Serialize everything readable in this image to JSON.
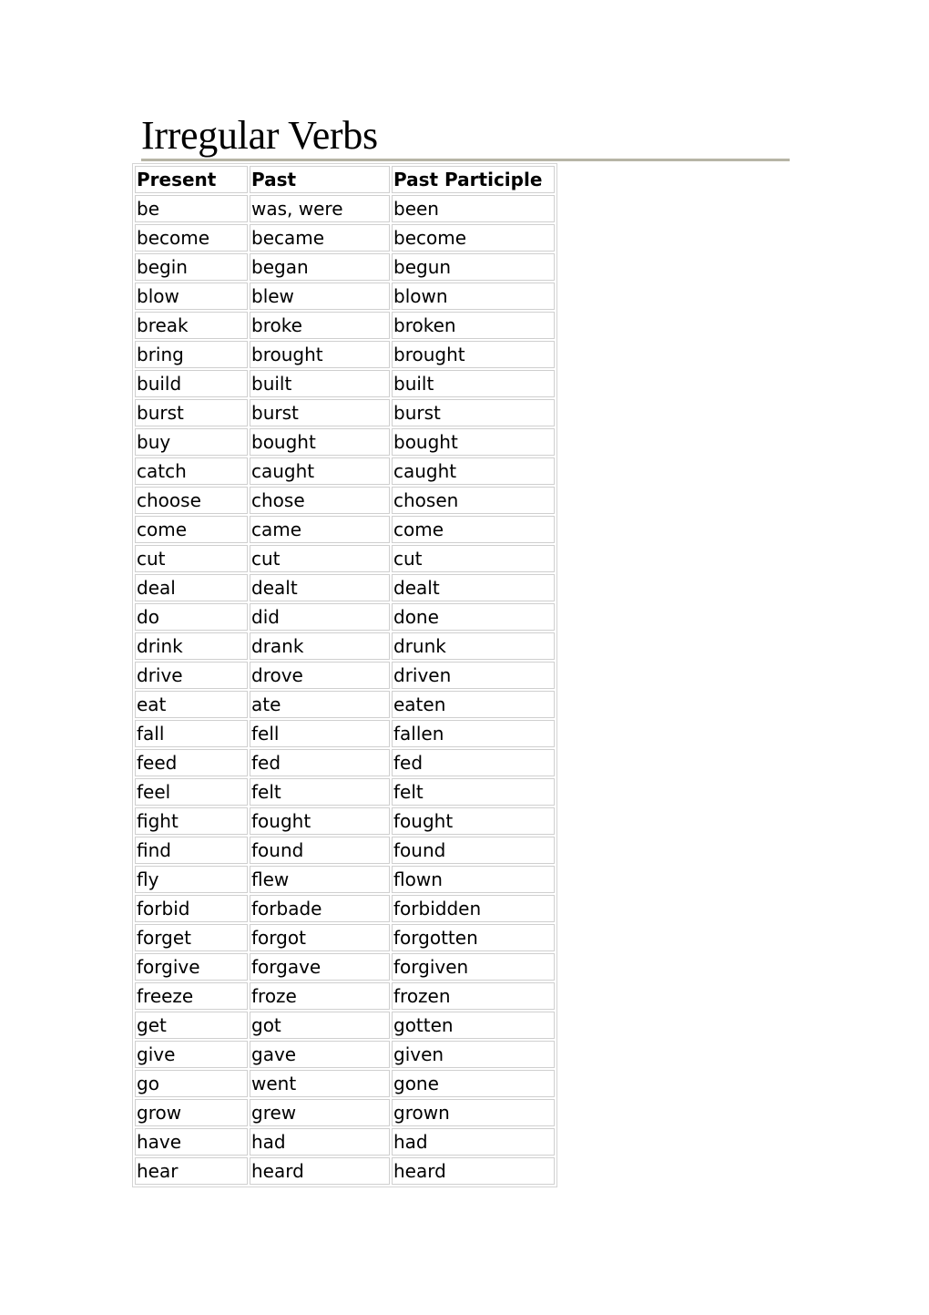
{
  "title": "Irregular Verbs",
  "table": {
    "headers": [
      "Present",
      "Past",
      "Past Participle"
    ],
    "rows": [
      [
        "be",
        "was, were",
        "been"
      ],
      [
        "become",
        "became",
        "become"
      ],
      [
        "begin",
        "began",
        "begun"
      ],
      [
        "blow",
        "blew",
        "blown"
      ],
      [
        "break",
        "broke",
        "broken"
      ],
      [
        "bring",
        "brought",
        "brought"
      ],
      [
        "build",
        "built",
        "built"
      ],
      [
        "burst",
        "burst",
        "burst"
      ],
      [
        "buy",
        "bought",
        "bought"
      ],
      [
        "catch",
        "caught",
        "caught"
      ],
      [
        "choose",
        "chose",
        "chosen"
      ],
      [
        "come",
        "came",
        "come"
      ],
      [
        "cut",
        "cut",
        "cut"
      ],
      [
        "deal",
        "dealt",
        "dealt"
      ],
      [
        "do",
        "did",
        "done"
      ],
      [
        "drink",
        "drank",
        "drunk"
      ],
      [
        "drive",
        "drove",
        "driven"
      ],
      [
        "eat",
        "ate",
        "eaten"
      ],
      [
        "fall",
        "fell",
        "fallen"
      ],
      [
        "feed",
        "fed",
        "fed"
      ],
      [
        "feel",
        "felt",
        "felt"
      ],
      [
        "fight",
        "fought",
        "fought"
      ],
      [
        "find",
        "found",
        "found"
      ],
      [
        "fly",
        "flew",
        "flown"
      ],
      [
        "forbid",
        "forbade",
        "forbidden"
      ],
      [
        "forget",
        "forgot",
        "forgotten"
      ],
      [
        "forgive",
        "forgave",
        "forgiven"
      ],
      [
        "freeze",
        "froze",
        "frozen"
      ],
      [
        "get",
        "got",
        "gotten"
      ],
      [
        "give",
        "gave",
        "given"
      ],
      [
        "go",
        "went",
        "gone"
      ],
      [
        "grow",
        "grew",
        "grown"
      ],
      [
        "have",
        "had",
        "had"
      ],
      [
        "hear",
        "heard",
        "heard"
      ]
    ]
  }
}
